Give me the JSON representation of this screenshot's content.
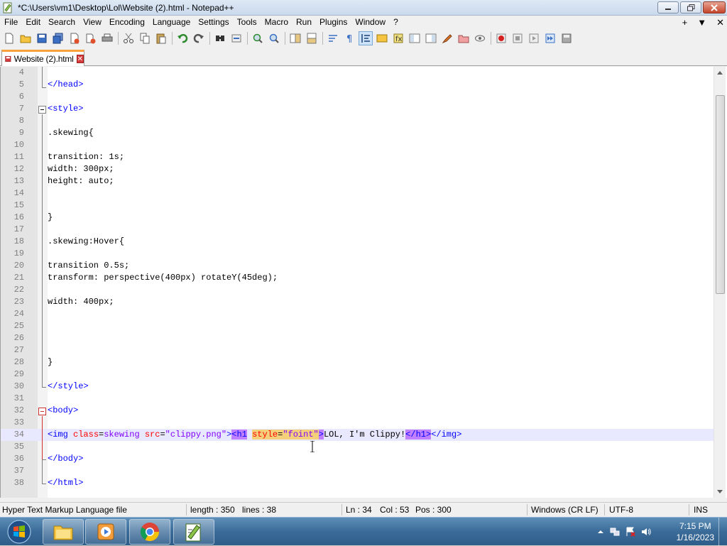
{
  "window": {
    "title": "*C:\\Users\\vm1\\Desktop\\Lol\\Website (2).html - Notepad++"
  },
  "menu": {
    "items": [
      "File",
      "Edit",
      "Search",
      "View",
      "Encoding",
      "Language",
      "Settings",
      "Tools",
      "Macro",
      "Run",
      "Plugins",
      "Window",
      "?"
    ],
    "right": [
      "+",
      "▼",
      "✕"
    ]
  },
  "toolbar": {
    "icons": [
      "new-file-icon",
      "open-file-icon",
      "save-icon",
      "save-all-icon",
      "close-icon",
      "close-all-icon",
      "print-icon",
      "cut-icon",
      "copy-icon",
      "paste-icon",
      "undo-icon",
      "redo-icon",
      "find-icon",
      "replace-icon",
      "zoom-in-icon",
      "zoom-out-icon",
      "sync-vertical-icon",
      "sync-horizontal-icon",
      "word-wrap-icon",
      "show-all-chars-icon",
      "indent-guide-icon",
      "doc-map-icon",
      "function-list-icon",
      "folder-workspace-icon",
      "monitoring-icon",
      "record-macro-icon",
      "stop-macro-icon",
      "play-macro-icon",
      "run-macro-multiple-icon",
      "save-macro-icon"
    ]
  },
  "tabs": [
    {
      "label": "Website (2).html"
    }
  ],
  "editor": {
    "lines": [
      {
        "n": "4",
        "text": ""
      },
      {
        "n": "5",
        "text": "</head>"
      },
      {
        "n": "6",
        "text": ""
      },
      {
        "n": "7",
        "text": "<style>"
      },
      {
        "n": "8",
        "text": ""
      },
      {
        "n": "9",
        "text": ".skewing{"
      },
      {
        "n": "10",
        "text": ""
      },
      {
        "n": "11",
        "text": "transition: 1s;"
      },
      {
        "n": "12",
        "text": "width: 300px;"
      },
      {
        "n": "13",
        "text": "height: auto;"
      },
      {
        "n": "14",
        "text": ""
      },
      {
        "n": "15",
        "text": ""
      },
      {
        "n": "16",
        "text": "}"
      },
      {
        "n": "17",
        "text": ""
      },
      {
        "n": "18",
        "text": ".skewing:Hover{"
      },
      {
        "n": "19",
        "text": ""
      },
      {
        "n": "20",
        "text": "transition 0.5s;"
      },
      {
        "n": "21",
        "text": "transform: perspective(400px) rotateY(45deg);"
      },
      {
        "n": "22",
        "text": ""
      },
      {
        "n": "23",
        "text": "width: 400px;"
      },
      {
        "n": "24",
        "text": ""
      },
      {
        "n": "25",
        "text": ""
      },
      {
        "n": "26",
        "text": ""
      },
      {
        "n": "27",
        "text": ""
      },
      {
        "n": "28",
        "text": "}"
      },
      {
        "n": "29",
        "text": ""
      },
      {
        "n": "30",
        "text": "</style>"
      },
      {
        "n": "31",
        "text": ""
      },
      {
        "n": "32",
        "text": "<body>"
      },
      {
        "n": "33",
        "text": ""
      },
      {
        "n": "34",
        "text": "<img class=skewing src=\"clippy.png\"><h1 style=\"foint\">LOL, I'm Clippy!</h1></img>"
      },
      {
        "n": "35",
        "text": ""
      },
      {
        "n": "36",
        "text": "</body>"
      },
      {
        "n": "37",
        "text": ""
      },
      {
        "n": "38",
        "text": "</html>"
      }
    ],
    "line34_parts": {
      "p1": "<img ",
      "p2": "class",
      "p3": "=",
      "p4": "skewing",
      "p5": " ",
      "p6": "src",
      "p7": "=",
      "p8": "\"clippy.png\"",
      "p9": ">",
      "p10": "<h1",
      "p11": " ",
      "p12": "style",
      "p13": "=",
      "p14": "\"foint\"",
      "p15": ">",
      "p16": "LOL, I'm Clippy!",
      "p17": "</h1>",
      "p18": "</img>"
    }
  },
  "status": {
    "filetype": "Hyper Text Markup Language file",
    "length": "length : 350",
    "lines": "lines : 38",
    "ln": "Ln : 34",
    "col": "Col : 53",
    "pos": "Pos : 300",
    "eol": "Windows (CR LF)",
    "encoding": "UTF-8",
    "mode": "INS"
  },
  "taskbar": {
    "apps": [
      "file-explorer-icon",
      "media-player-icon",
      "chrome-icon",
      "notepad-plus-plus-icon"
    ],
    "time": "7:15 PM",
    "date": "1/16/2023"
  },
  "colors": {
    "tag": "#0000ff",
    "attr": "#ff0000",
    "value": "#8000ff",
    "tab_accent": "#f9a23b"
  }
}
